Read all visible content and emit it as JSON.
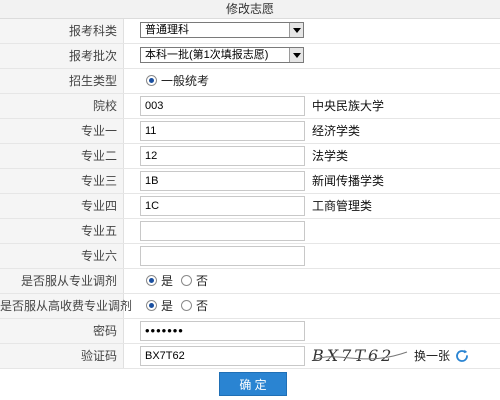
{
  "page": {
    "title": "修改志愿"
  },
  "form": {
    "subject_type": {
      "label": "报考科类",
      "value": "普通理科"
    },
    "batch": {
      "label": "报考批次",
      "value": "本科一批(第1次填报志愿)"
    },
    "admission_type": {
      "label": "招生类型",
      "option": "一般统考"
    },
    "school": {
      "label": "院校",
      "code": "003",
      "name": "中央民族大学"
    },
    "majors": [
      {
        "label": "专业一",
        "code": "11",
        "name": "经济学类"
      },
      {
        "label": "专业二",
        "code": "12",
        "name": "法学类"
      },
      {
        "label": "专业三",
        "code": "1B",
        "name": "新闻传播学类"
      },
      {
        "label": "专业四",
        "code": "1C",
        "name": "工商管理类"
      },
      {
        "label": "专业五",
        "code": "",
        "name": ""
      },
      {
        "label": "专业六",
        "code": "",
        "name": ""
      }
    ],
    "adjust_major": {
      "label": "是否服从专业调剂",
      "yes": "是",
      "no": "否",
      "selected": "yes"
    },
    "adjust_high_fee": {
      "label": "是否服从高收费专业调剂",
      "yes": "是",
      "no": "否",
      "selected": "yes"
    },
    "password": {
      "label": "密码",
      "value": "•••••••"
    },
    "captcha": {
      "label": "验证码",
      "value": "BX7T62",
      "image_text": "BX7T62",
      "refresh_label": "换一张"
    }
  },
  "actions": {
    "submit_label": "确 定"
  },
  "colors": {
    "button": "#2a84d2",
    "radio_fill": "#1a4fa0",
    "label_bg": "#f5f5f5"
  },
  "icons": {
    "refresh": "refresh-icon",
    "dropdown": "chevron-down-icon"
  }
}
